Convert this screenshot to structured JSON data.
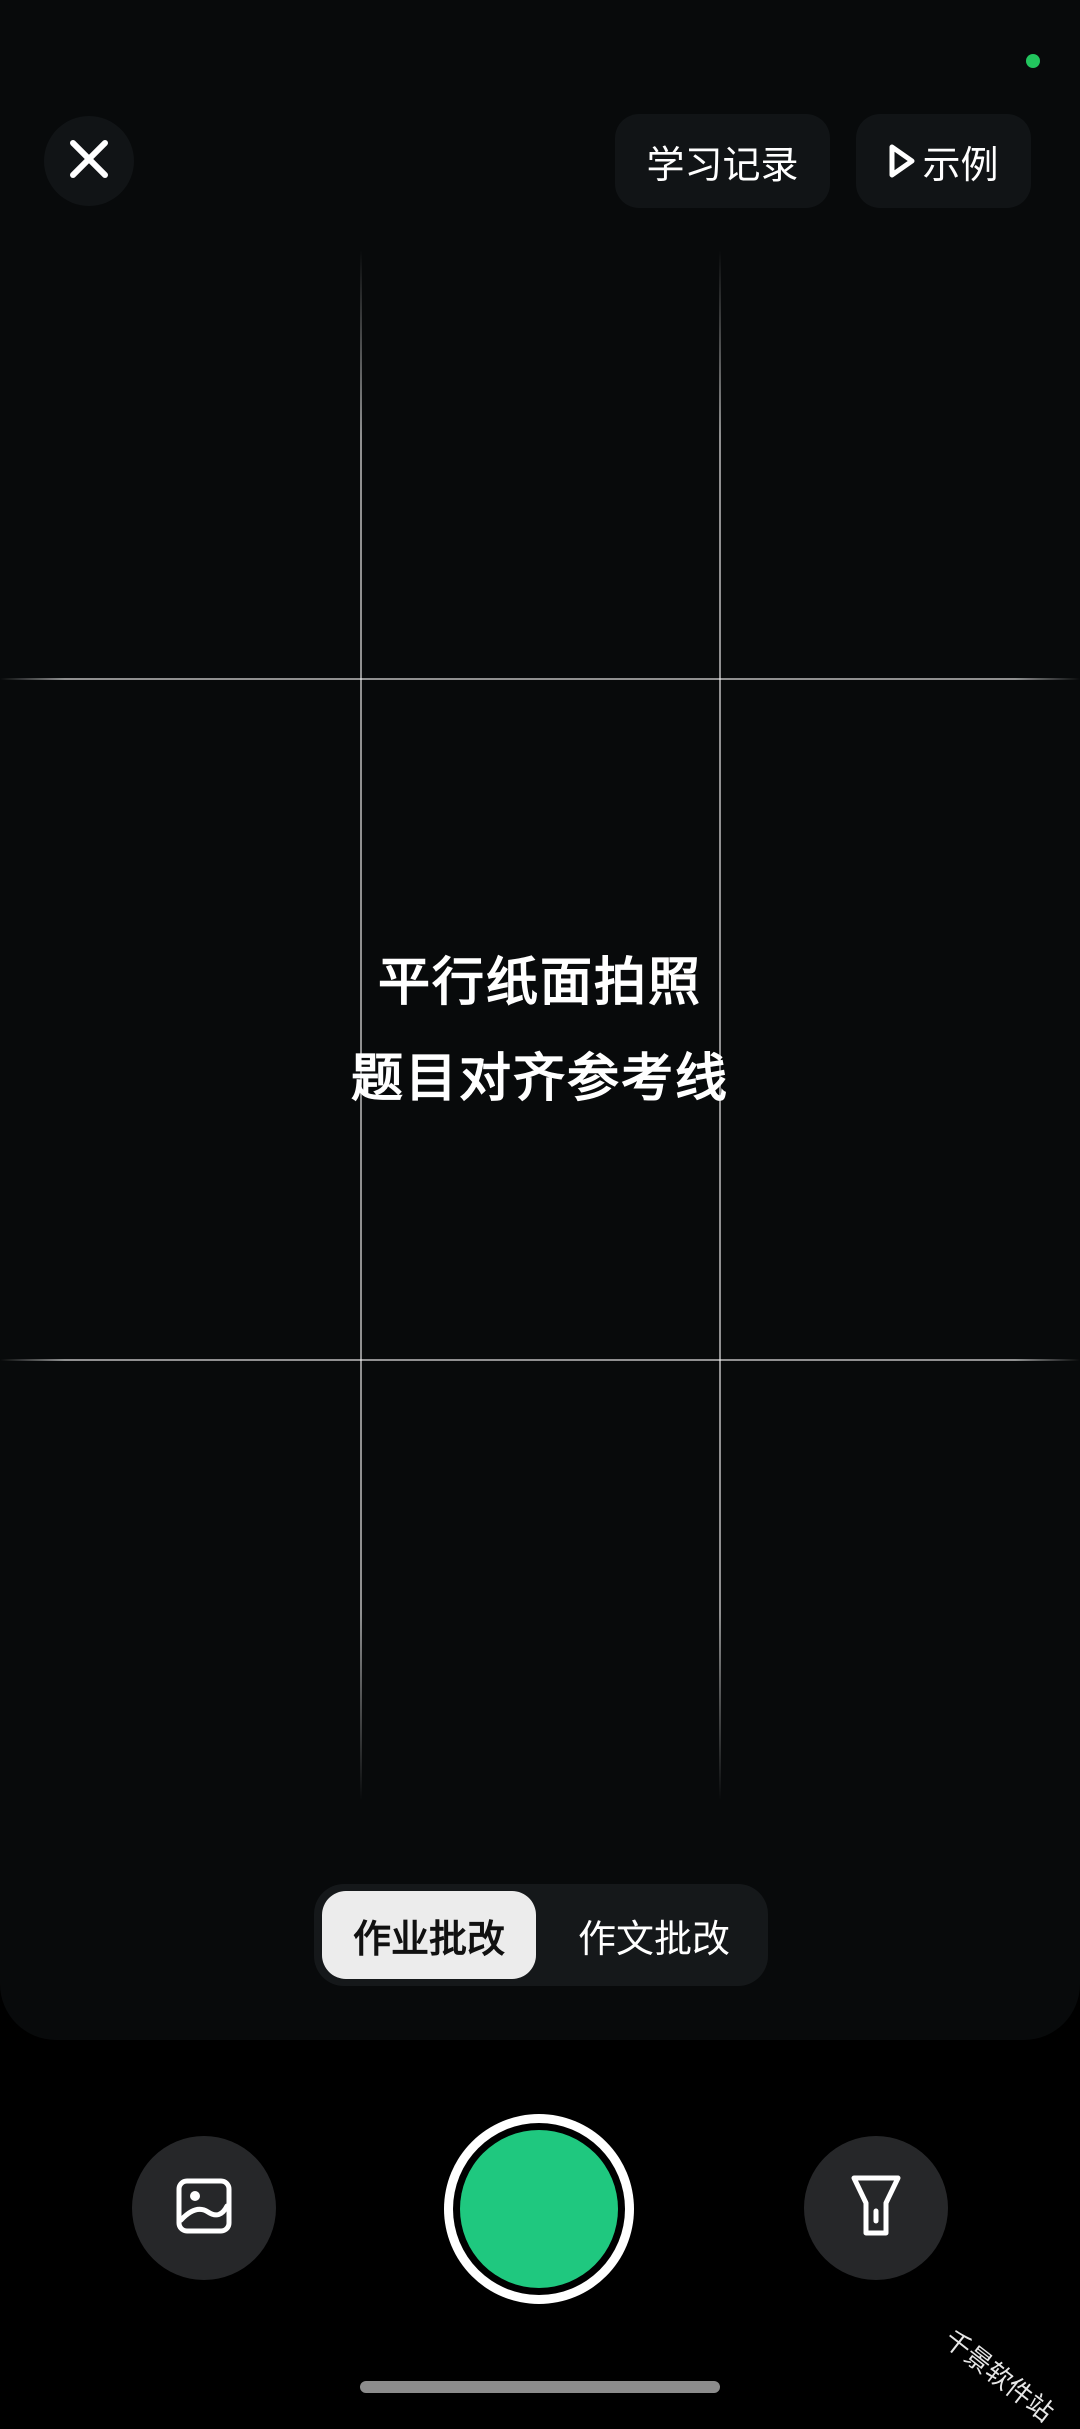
{
  "header": {
    "history_label": "学习记录",
    "example_label": "示例"
  },
  "hint": {
    "line1": "平行纸面拍照",
    "line2": "题目对齐参考线"
  },
  "mode_switch": {
    "active_label": "作业批改",
    "inactive_label": "作文批改"
  },
  "icons": {
    "close": "close-icon",
    "play": "play-icon",
    "gallery": "image-icon",
    "flashlight": "flashlight-icon"
  },
  "watermark": "千景软件站",
  "colors": {
    "accent": "#1fc87f",
    "status_dot": "#22c55e",
    "background": "#080a0b"
  }
}
